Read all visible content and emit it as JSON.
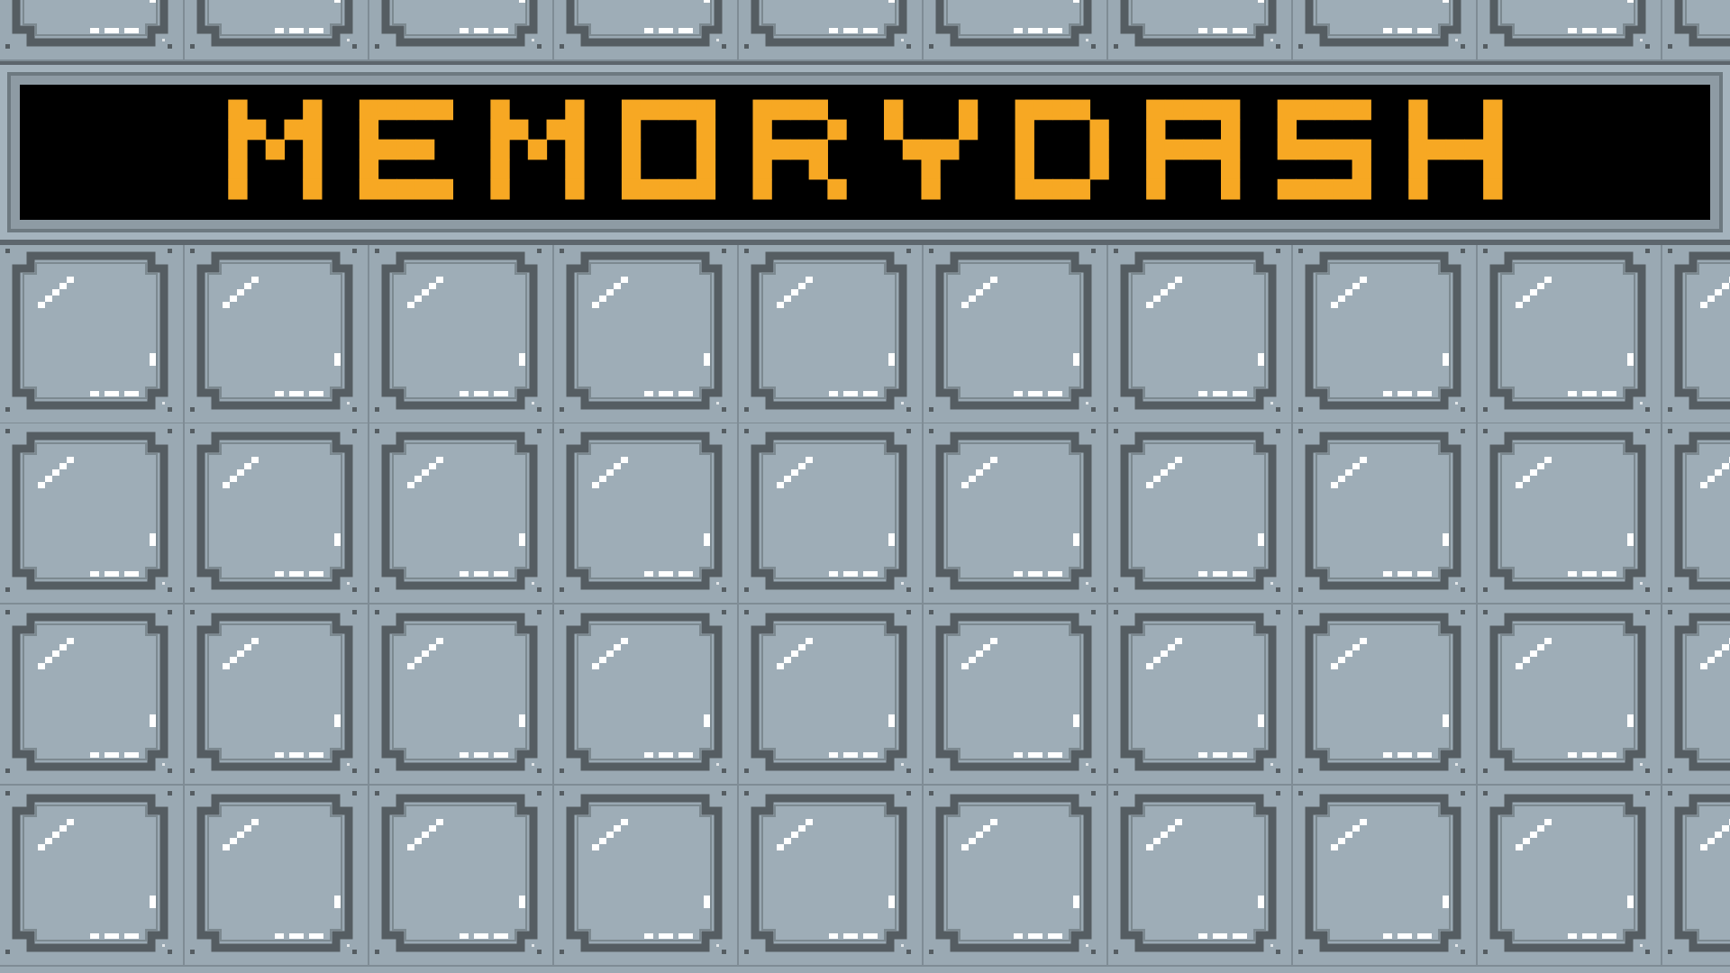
{
  "game": {
    "title": "MEMORYDASH"
  },
  "board": {
    "visible_rows": 5,
    "visible_columns": 10,
    "tile_state": "face-down"
  },
  "colors": {
    "background": "#9aa9b3",
    "title": "#f7a823",
    "banner_screen": "#000000",
    "tile_outline": "#555d62",
    "tile_highlight": "#ffffff"
  }
}
